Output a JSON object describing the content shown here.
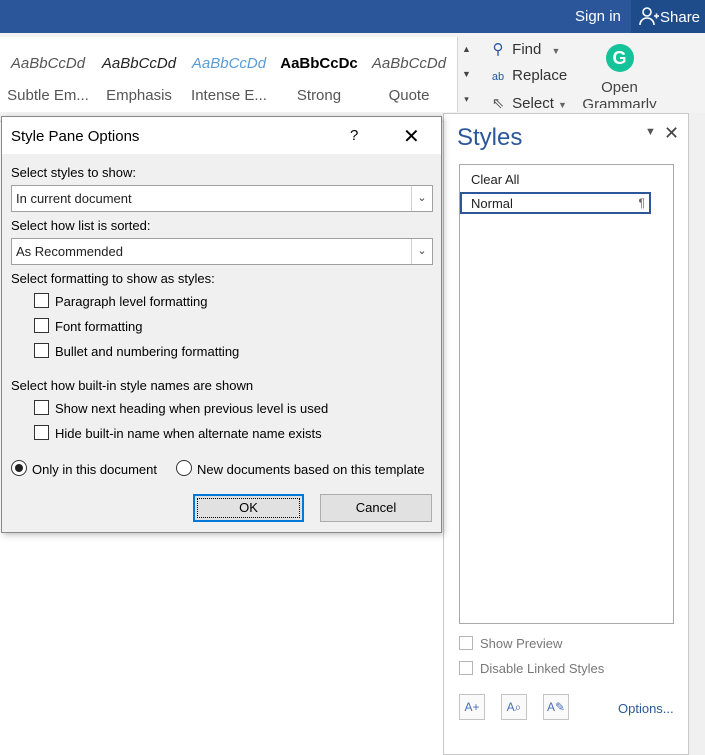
{
  "titlebar": {
    "signin": "Sign in",
    "share": "Share",
    "share_icon": "person-add-icon"
  },
  "ribbon": {
    "styles_gallery": [
      {
        "preview": "AaBbCcDd",
        "name": "Subtle Em..."
      },
      {
        "preview": "AaBbCcDd",
        "name": "Emphasis"
      },
      {
        "preview": "AaBbCcDd",
        "name": "Intense E..."
      },
      {
        "preview": "AaBbCcDc",
        "name": "Strong"
      },
      {
        "preview": "AaBbCcDd",
        "name": "Quote"
      }
    ],
    "editing": {
      "find": "Find",
      "replace": "Replace",
      "select": "Select"
    },
    "grammarly": {
      "line1": "Open",
      "line2": "Grammarly"
    }
  },
  "styles_pane": {
    "title": "Styles",
    "items": [
      "Clear All",
      "Normal"
    ],
    "paragraph_mark": "¶",
    "show_preview": "Show Preview",
    "disable_linked": "Disable Linked Styles",
    "options_link": "Options..."
  },
  "dialog": {
    "title": "Style Pane Options",
    "help": "?",
    "select_styles_label": "Select styles to show:",
    "select_styles_value": "In current document",
    "sort_label": "Select how list is sorted:",
    "sort_value": "As Recommended",
    "formatting_label": "Select formatting to show as styles:",
    "formatting_options": [
      {
        "label": "Paragraph level formatting",
        "checked": false
      },
      {
        "label": "Font formatting",
        "checked": false
      },
      {
        "label": "Bullet and numbering formatting",
        "checked": false
      }
    ],
    "builtin_label": "Select how built-in style names are shown",
    "builtin_options": [
      {
        "label": "Show next heading when previous level is used",
        "checked": false
      },
      {
        "label": "Hide built-in name when alternate name exists",
        "checked": false
      }
    ],
    "scope_options": [
      {
        "label": "Only in this document",
        "selected": true
      },
      {
        "label": "New documents based on this template",
        "selected": false
      }
    ],
    "ok": "OK",
    "cancel": "Cancel"
  }
}
